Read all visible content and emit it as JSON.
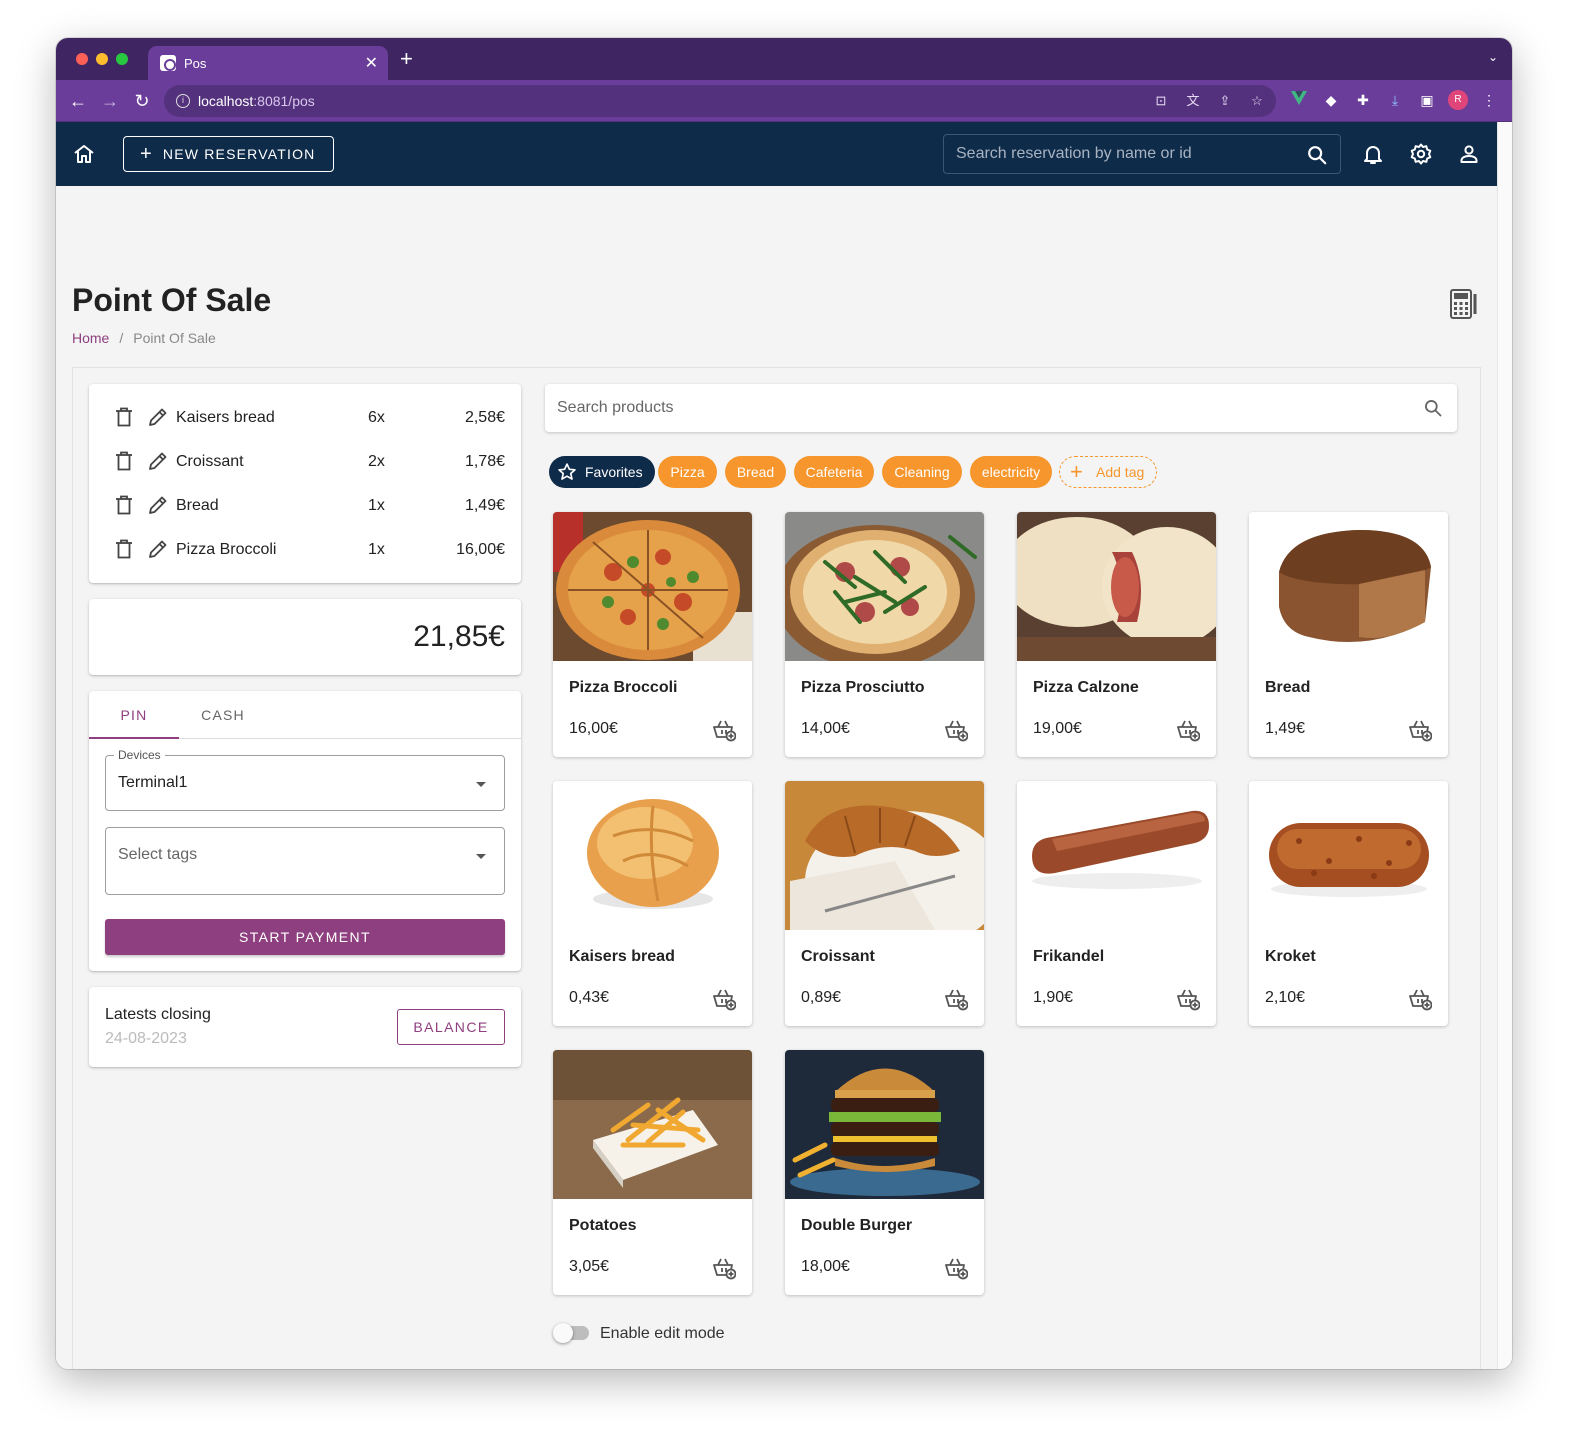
{
  "browser": {
    "tab_title": "Pos",
    "url_host": "localhost",
    "url_rest": ":8081/pos",
    "profile_initial": "R"
  },
  "appbar": {
    "new_reservation_label": "NEW RESERVATION",
    "search_placeholder": "Search reservation by name or id"
  },
  "page": {
    "title": "Point Of Sale",
    "breadcrumb": [
      "Home",
      "Point Of Sale"
    ],
    "breadcrumb_separator": "/"
  },
  "order": {
    "items": [
      {
        "name": "Kaisers bread",
        "qty": "6x",
        "price": "2,58€"
      },
      {
        "name": "Croissant",
        "qty": "2x",
        "price": "1,78€"
      },
      {
        "name": "Bread",
        "qty": "1x",
        "price": "1,49€"
      },
      {
        "name": "Pizza Broccoli",
        "qty": "1x",
        "price": "16,00€"
      }
    ],
    "total": "21,85€"
  },
  "payment": {
    "tabs": [
      "PIN",
      "CASH"
    ],
    "active_tab": "PIN",
    "devices_label": "Devices",
    "devices_value": "Terminal1",
    "tags_placeholder": "Select tags",
    "start_label": "START PAYMENT"
  },
  "closing": {
    "label": "Latests closing",
    "date": "24-08-2023",
    "balance_label": "BALANCE"
  },
  "products_search_placeholder": "Search products",
  "tags": {
    "favorites": "Favorites",
    "items": [
      "Pizza",
      "Bread",
      "Cafeteria",
      "Cleaning",
      "electricity"
    ],
    "add": "Add tag"
  },
  "products": [
    {
      "name": "Pizza Broccoli",
      "price": "16,00€"
    },
    {
      "name": "Pizza Prosciutto",
      "price": "14,00€"
    },
    {
      "name": "Pizza Calzone",
      "price": "19,00€"
    },
    {
      "name": "Bread",
      "price": "1,49€"
    },
    {
      "name": "Kaisers bread",
      "price": "0,43€"
    },
    {
      "name": "Croissant",
      "price": "0,89€"
    },
    {
      "name": "Frikandel",
      "price": "1,90€"
    },
    {
      "name": "Kroket",
      "price": "2,10€"
    },
    {
      "name": "Potatoes",
      "price": "3,05€"
    },
    {
      "name": "Double Burger",
      "price": "18,00€"
    }
  ],
  "edit_mode": {
    "label": "Enable edit mode",
    "enabled": false
  },
  "colors": {
    "brand_dark": "#0f2b4a",
    "accent_purple": "#8e3f7f",
    "tag_orange": "#f7962c",
    "browser_purple": "#6a3d9a"
  }
}
